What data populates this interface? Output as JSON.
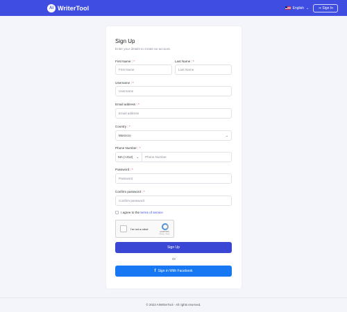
{
  "header": {
    "logo_badge": "AI",
    "logo_text": "WriterTool",
    "language": "English",
    "signin_label": "Sign In",
    "brand_color": "#3f4de0"
  },
  "form": {
    "title": "Sign Up",
    "subtitle": "Enter your details to create an account.",
    "first_name": {
      "label": "First Name :",
      "placeholder": "First Name"
    },
    "last_name": {
      "label": "Last Name :",
      "placeholder": "Last Name"
    },
    "username": {
      "label": "Username :",
      "placeholder": "Username"
    },
    "email": {
      "label": "Email address :",
      "placeholder": "Email address"
    },
    "country": {
      "label": "Country :",
      "value": "Morocco"
    },
    "phone": {
      "label": "Phone Number :",
      "code": "MA (+212)",
      "placeholder": "Phone Number"
    },
    "password": {
      "label": "Password :",
      "placeholder": "Password"
    },
    "confirm_password": {
      "label": "Confirm password :",
      "placeholder": "Confirm password"
    },
    "agree_prefix": "I agree to the",
    "agree_link": "terms of service",
    "recaptcha": {
      "label": "I'm not a robot",
      "brand": "reCAPTCHA",
      "small": "Privacy - Terms"
    },
    "submit_label": "Sign Up",
    "or_label": "Or",
    "facebook_label": "Sign in With Facebook"
  },
  "footer": {
    "text": "© 2023 AIWriterTool - All rights reserved."
  },
  "icons": {
    "flag": "us-flag-icon",
    "chevron": "chevron-down-icon",
    "signin": "signin-icon",
    "facebook": "facebook-icon"
  }
}
